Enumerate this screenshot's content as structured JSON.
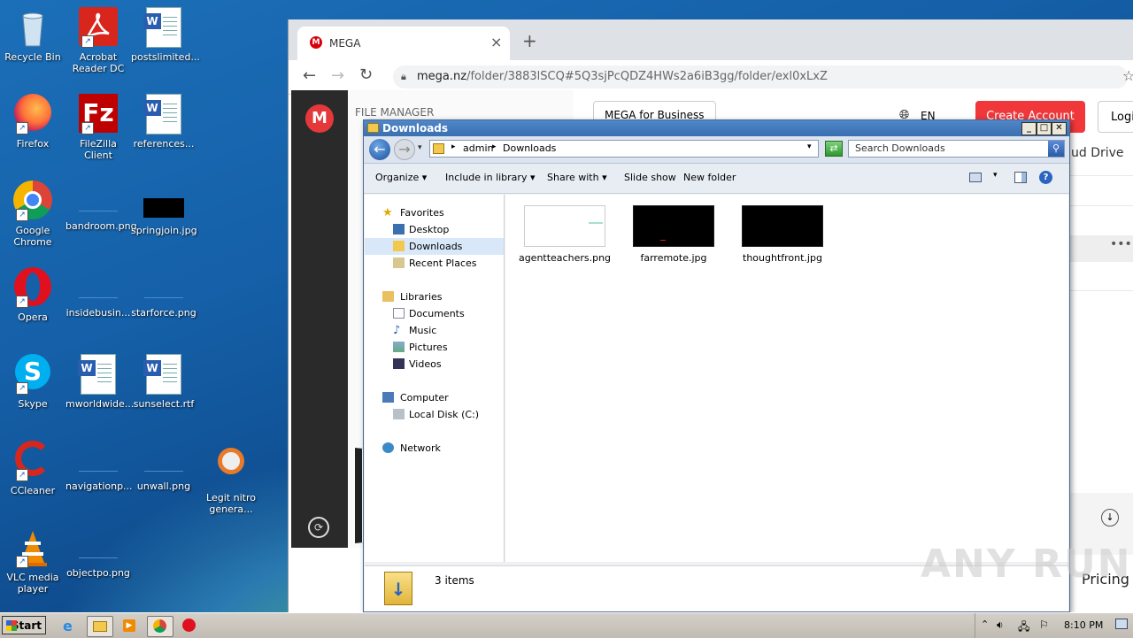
{
  "desktop": {
    "icons": [
      {
        "label": "Recycle Bin"
      },
      {
        "label": "Acrobat Reader DC"
      },
      {
        "label": "postslimited..."
      },
      {
        "label": "Firefox"
      },
      {
        "label": "FileZilla Client"
      },
      {
        "label": "references..."
      },
      {
        "label": "Google Chrome"
      },
      {
        "label": "bandroom.png"
      },
      {
        "label": "springjoin.jpg"
      },
      {
        "label": "Opera"
      },
      {
        "label": "insidebusin..."
      },
      {
        "label": "starforce.png"
      },
      {
        "label": "Skype"
      },
      {
        "label": "mworldwide..."
      },
      {
        "label": "sunselect.rtf"
      },
      {
        "label": "CCleaner"
      },
      {
        "label": "navigationp..."
      },
      {
        "label": "unwall.png"
      },
      {
        "label": "Legit nitro genera..."
      },
      {
        "label": "VLC media player"
      },
      {
        "label": "objectpo.png"
      }
    ]
  },
  "browser": {
    "tab_title": "MEGA",
    "url_host": "mega.nz",
    "url_path": "/folder/3883lSCQ#5Q3sjPcQDZ4HWs2a6iB3gg/folder/exl0xLxZ",
    "mega": {
      "section": "FILE MANAGER",
      "business_btn": "MEGA for Business",
      "lang": "EN",
      "create_account": "Create Account",
      "login": "Login",
      "cloud_drive": "ud Drive",
      "pricing": "Pricing"
    }
  },
  "explorer": {
    "title": "Downloads",
    "breadcrumb": [
      "admin",
      "Downloads"
    ],
    "search_placeholder": "Search Downloads",
    "toolbar": {
      "organize": "Organize",
      "include": "Include in library",
      "share": "Share with",
      "slideshow": "Slide show",
      "newfolder": "New folder"
    },
    "nav": {
      "favorites": "Favorites",
      "desktop": "Desktop",
      "downloads": "Downloads",
      "recent": "Recent Places",
      "libraries": "Libraries",
      "documents": "Documents",
      "music": "Music",
      "pictures": "Pictures",
      "videos": "Videos",
      "computer": "Computer",
      "localdisk": "Local Disk (C:)",
      "network": "Network"
    },
    "files": [
      {
        "name": "agentteachers.png",
        "thumb": "#ffffff"
      },
      {
        "name": "farremote.jpg",
        "thumb": "#000000"
      },
      {
        "name": "thoughtfront.jpg",
        "thumb": "#000000"
      }
    ],
    "item_count": "3 items"
  },
  "taskbar": {
    "start": "Start",
    "clock": "8:10 PM"
  },
  "watermark": "ANY RUN"
}
